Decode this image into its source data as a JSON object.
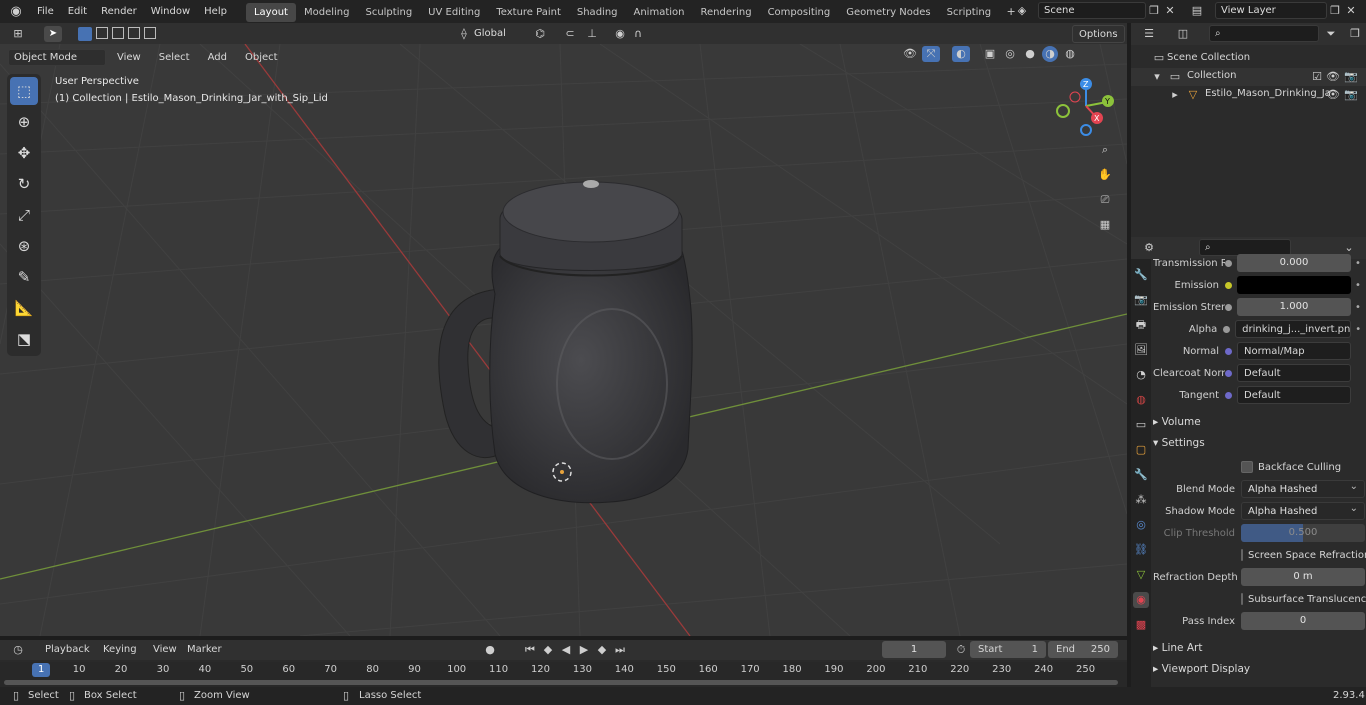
{
  "menus": [
    "File",
    "Edit",
    "Render",
    "Window",
    "Help"
  ],
  "workspaces": [
    "Layout",
    "Modeling",
    "Sculpting",
    "UV Editing",
    "Texture Paint",
    "Shading",
    "Animation",
    "Rendering",
    "Compositing",
    "Geometry Nodes",
    "Scripting"
  ],
  "scene_name": "Scene",
  "view_layer": "View Layer",
  "viewport_header": {
    "transform": "Global",
    "options": "Options",
    "mode": "Object Mode",
    "menus": [
      "View",
      "Select",
      "Add",
      "Object"
    ]
  },
  "viewport": {
    "perspective": "User Perspective",
    "collection_info": "(1) Collection | Estilo_Mason_Drinking_Jar_with_Sip_Lid",
    "axes": {
      "x": "X",
      "y": "Y",
      "z": "Z"
    }
  },
  "outliner": {
    "search_placeholder": "",
    "scene_collection": "Scene Collection",
    "collection": "Collection",
    "object": "Estilo_Mason_Drinking_Ja"
  },
  "properties": {
    "rows": [
      {
        "label": "Transmission R...",
        "value": "0.000"
      },
      {
        "label": "Emission",
        "value": ""
      },
      {
        "label": "Emission Strengt",
        "value": "1.000"
      },
      {
        "label": "Alpha",
        "value": "drinking_j..._invert.pn"
      },
      {
        "label": "Normal",
        "value": "Normal/Map"
      },
      {
        "label": "Clearcoat Normal",
        "value": "Default"
      },
      {
        "label": "Tangent",
        "value": "Default"
      }
    ],
    "volume": "Volume",
    "settings": "Settings",
    "backface_culling": "Backface Culling",
    "blend_mode_label": "Blend Mode",
    "blend_mode": "Alpha Hashed",
    "shadow_mode_label": "Shadow Mode",
    "shadow_mode": "Alpha Hashed",
    "clip_threshold_label": "Clip Threshold",
    "clip_threshold": "0.500",
    "screen_space_refraction": "Screen Space Refraction",
    "refraction_depth_label": "Refraction Depth",
    "refraction_depth": "0 m",
    "subsurface_translucency": "Subsurface Translucency",
    "pass_index_label": "Pass Index",
    "pass_index": "0",
    "line_art": "Line Art",
    "viewport_display": "Viewport Display"
  },
  "timeline": {
    "menus": [
      "Playback",
      "Keying",
      "View",
      "Marker"
    ],
    "current_frame": "1",
    "start_label": "Start",
    "start": "1",
    "end_label": "End",
    "end": "250",
    "ticks": [
      "1",
      "10",
      "20",
      "30",
      "40",
      "50",
      "60",
      "70",
      "80",
      "90",
      "100",
      "110",
      "120",
      "130",
      "140",
      "150",
      "160",
      "170",
      "180",
      "190",
      "200",
      "210",
      "220",
      "230",
      "240",
      "250"
    ]
  },
  "status": {
    "select": "Select",
    "box_select": "Box Select",
    "zoom_view": "Zoom View",
    "lasso_select": "Lasso Select",
    "version": "2.93.4"
  },
  "colors": {
    "accent": "#4772b3",
    "x_axis": "#e34451",
    "y_axis": "#8cc23b",
    "z_axis": "#3c8de6"
  }
}
